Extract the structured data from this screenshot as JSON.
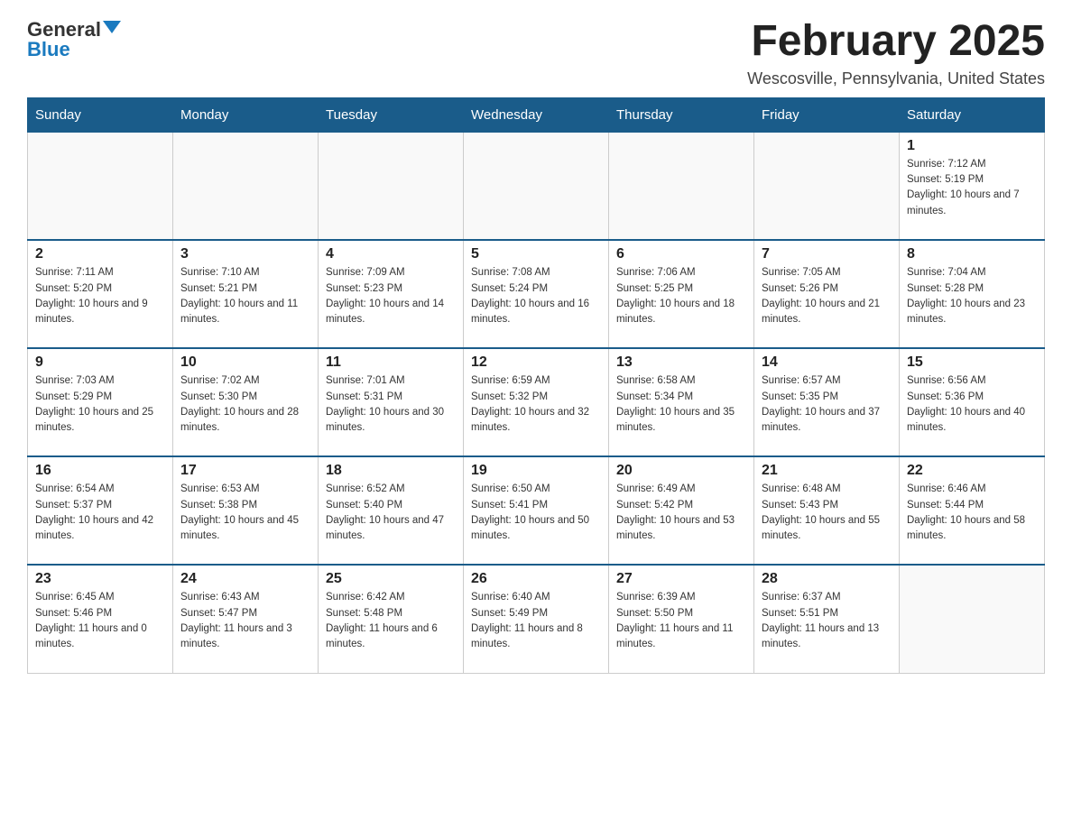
{
  "header": {
    "logo_general": "General",
    "logo_blue": "Blue",
    "month_title": "February 2025",
    "location": "Wescosville, Pennsylvania, United States"
  },
  "weekdays": [
    "Sunday",
    "Monday",
    "Tuesday",
    "Wednesday",
    "Thursday",
    "Friday",
    "Saturday"
  ],
  "weeks": [
    [
      {
        "day": "",
        "sunrise": "",
        "sunset": "",
        "daylight": ""
      },
      {
        "day": "",
        "sunrise": "",
        "sunset": "",
        "daylight": ""
      },
      {
        "day": "",
        "sunrise": "",
        "sunset": "",
        "daylight": ""
      },
      {
        "day": "",
        "sunrise": "",
        "sunset": "",
        "daylight": ""
      },
      {
        "day": "",
        "sunrise": "",
        "sunset": "",
        "daylight": ""
      },
      {
        "day": "",
        "sunrise": "",
        "sunset": "",
        "daylight": ""
      },
      {
        "day": "1",
        "sunrise": "Sunrise: 7:12 AM",
        "sunset": "Sunset: 5:19 PM",
        "daylight": "Daylight: 10 hours and 7 minutes."
      }
    ],
    [
      {
        "day": "2",
        "sunrise": "Sunrise: 7:11 AM",
        "sunset": "Sunset: 5:20 PM",
        "daylight": "Daylight: 10 hours and 9 minutes."
      },
      {
        "day": "3",
        "sunrise": "Sunrise: 7:10 AM",
        "sunset": "Sunset: 5:21 PM",
        "daylight": "Daylight: 10 hours and 11 minutes."
      },
      {
        "day": "4",
        "sunrise": "Sunrise: 7:09 AM",
        "sunset": "Sunset: 5:23 PM",
        "daylight": "Daylight: 10 hours and 14 minutes."
      },
      {
        "day": "5",
        "sunrise": "Sunrise: 7:08 AM",
        "sunset": "Sunset: 5:24 PM",
        "daylight": "Daylight: 10 hours and 16 minutes."
      },
      {
        "day": "6",
        "sunrise": "Sunrise: 7:06 AM",
        "sunset": "Sunset: 5:25 PM",
        "daylight": "Daylight: 10 hours and 18 minutes."
      },
      {
        "day": "7",
        "sunrise": "Sunrise: 7:05 AM",
        "sunset": "Sunset: 5:26 PM",
        "daylight": "Daylight: 10 hours and 21 minutes."
      },
      {
        "day": "8",
        "sunrise": "Sunrise: 7:04 AM",
        "sunset": "Sunset: 5:28 PM",
        "daylight": "Daylight: 10 hours and 23 minutes."
      }
    ],
    [
      {
        "day": "9",
        "sunrise": "Sunrise: 7:03 AM",
        "sunset": "Sunset: 5:29 PM",
        "daylight": "Daylight: 10 hours and 25 minutes."
      },
      {
        "day": "10",
        "sunrise": "Sunrise: 7:02 AM",
        "sunset": "Sunset: 5:30 PM",
        "daylight": "Daylight: 10 hours and 28 minutes."
      },
      {
        "day": "11",
        "sunrise": "Sunrise: 7:01 AM",
        "sunset": "Sunset: 5:31 PM",
        "daylight": "Daylight: 10 hours and 30 minutes."
      },
      {
        "day": "12",
        "sunrise": "Sunrise: 6:59 AM",
        "sunset": "Sunset: 5:32 PM",
        "daylight": "Daylight: 10 hours and 32 minutes."
      },
      {
        "day": "13",
        "sunrise": "Sunrise: 6:58 AM",
        "sunset": "Sunset: 5:34 PM",
        "daylight": "Daylight: 10 hours and 35 minutes."
      },
      {
        "day": "14",
        "sunrise": "Sunrise: 6:57 AM",
        "sunset": "Sunset: 5:35 PM",
        "daylight": "Daylight: 10 hours and 37 minutes."
      },
      {
        "day": "15",
        "sunrise": "Sunrise: 6:56 AM",
        "sunset": "Sunset: 5:36 PM",
        "daylight": "Daylight: 10 hours and 40 minutes."
      }
    ],
    [
      {
        "day": "16",
        "sunrise": "Sunrise: 6:54 AM",
        "sunset": "Sunset: 5:37 PM",
        "daylight": "Daylight: 10 hours and 42 minutes."
      },
      {
        "day": "17",
        "sunrise": "Sunrise: 6:53 AM",
        "sunset": "Sunset: 5:38 PM",
        "daylight": "Daylight: 10 hours and 45 minutes."
      },
      {
        "day": "18",
        "sunrise": "Sunrise: 6:52 AM",
        "sunset": "Sunset: 5:40 PM",
        "daylight": "Daylight: 10 hours and 47 minutes."
      },
      {
        "day": "19",
        "sunrise": "Sunrise: 6:50 AM",
        "sunset": "Sunset: 5:41 PM",
        "daylight": "Daylight: 10 hours and 50 minutes."
      },
      {
        "day": "20",
        "sunrise": "Sunrise: 6:49 AM",
        "sunset": "Sunset: 5:42 PM",
        "daylight": "Daylight: 10 hours and 53 minutes."
      },
      {
        "day": "21",
        "sunrise": "Sunrise: 6:48 AM",
        "sunset": "Sunset: 5:43 PM",
        "daylight": "Daylight: 10 hours and 55 minutes."
      },
      {
        "day": "22",
        "sunrise": "Sunrise: 6:46 AM",
        "sunset": "Sunset: 5:44 PM",
        "daylight": "Daylight: 10 hours and 58 minutes."
      }
    ],
    [
      {
        "day": "23",
        "sunrise": "Sunrise: 6:45 AM",
        "sunset": "Sunset: 5:46 PM",
        "daylight": "Daylight: 11 hours and 0 minutes."
      },
      {
        "day": "24",
        "sunrise": "Sunrise: 6:43 AM",
        "sunset": "Sunset: 5:47 PM",
        "daylight": "Daylight: 11 hours and 3 minutes."
      },
      {
        "day": "25",
        "sunrise": "Sunrise: 6:42 AM",
        "sunset": "Sunset: 5:48 PM",
        "daylight": "Daylight: 11 hours and 6 minutes."
      },
      {
        "day": "26",
        "sunrise": "Sunrise: 6:40 AM",
        "sunset": "Sunset: 5:49 PM",
        "daylight": "Daylight: 11 hours and 8 minutes."
      },
      {
        "day": "27",
        "sunrise": "Sunrise: 6:39 AM",
        "sunset": "Sunset: 5:50 PM",
        "daylight": "Daylight: 11 hours and 11 minutes."
      },
      {
        "day": "28",
        "sunrise": "Sunrise: 6:37 AM",
        "sunset": "Sunset: 5:51 PM",
        "daylight": "Daylight: 11 hours and 13 minutes."
      },
      {
        "day": "",
        "sunrise": "",
        "sunset": "",
        "daylight": ""
      }
    ]
  ]
}
